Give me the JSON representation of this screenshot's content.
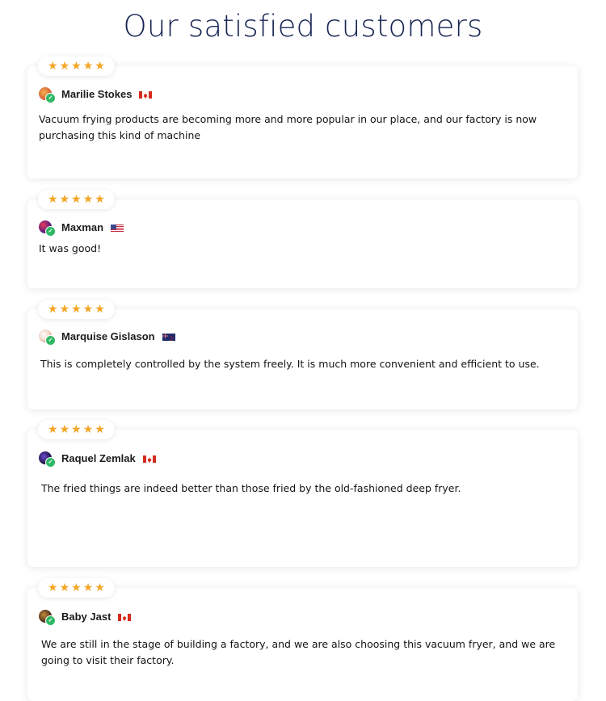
{
  "page": {
    "title": "Our satisfied customers"
  },
  "reviews": [
    {
      "rating": 5,
      "name": "Marilie Stokes",
      "country": "canada-flag",
      "text": "Vacuum frying products are becoming more and more popular in our place, and our factory is now purchasing this kind of machine"
    },
    {
      "rating": 5,
      "name": "Maxman",
      "country": "us-flag",
      "text": "It was good!"
    },
    {
      "rating": 5,
      "name": "Marquise Gislason",
      "country": "new-zealand-flag",
      "text": "This is completely controlled by the system freely. It is much more convenient and efficient to use."
    },
    {
      "rating": 5,
      "name": "Raquel Zemlak",
      "country": "canada-flag",
      "text": "The fried things are indeed better than those fried by the old-fashioned deep fryer."
    },
    {
      "rating": 5,
      "name": "Baby Jast",
      "country": "canada-flag",
      "text": "We are still in the stage of building a factory, and we are also choosing this vacuum fryer, and we are going to visit their factory."
    }
  ],
  "colors": {
    "title": "#172453",
    "star": "#f5a524",
    "verified": "#2fb865"
  }
}
